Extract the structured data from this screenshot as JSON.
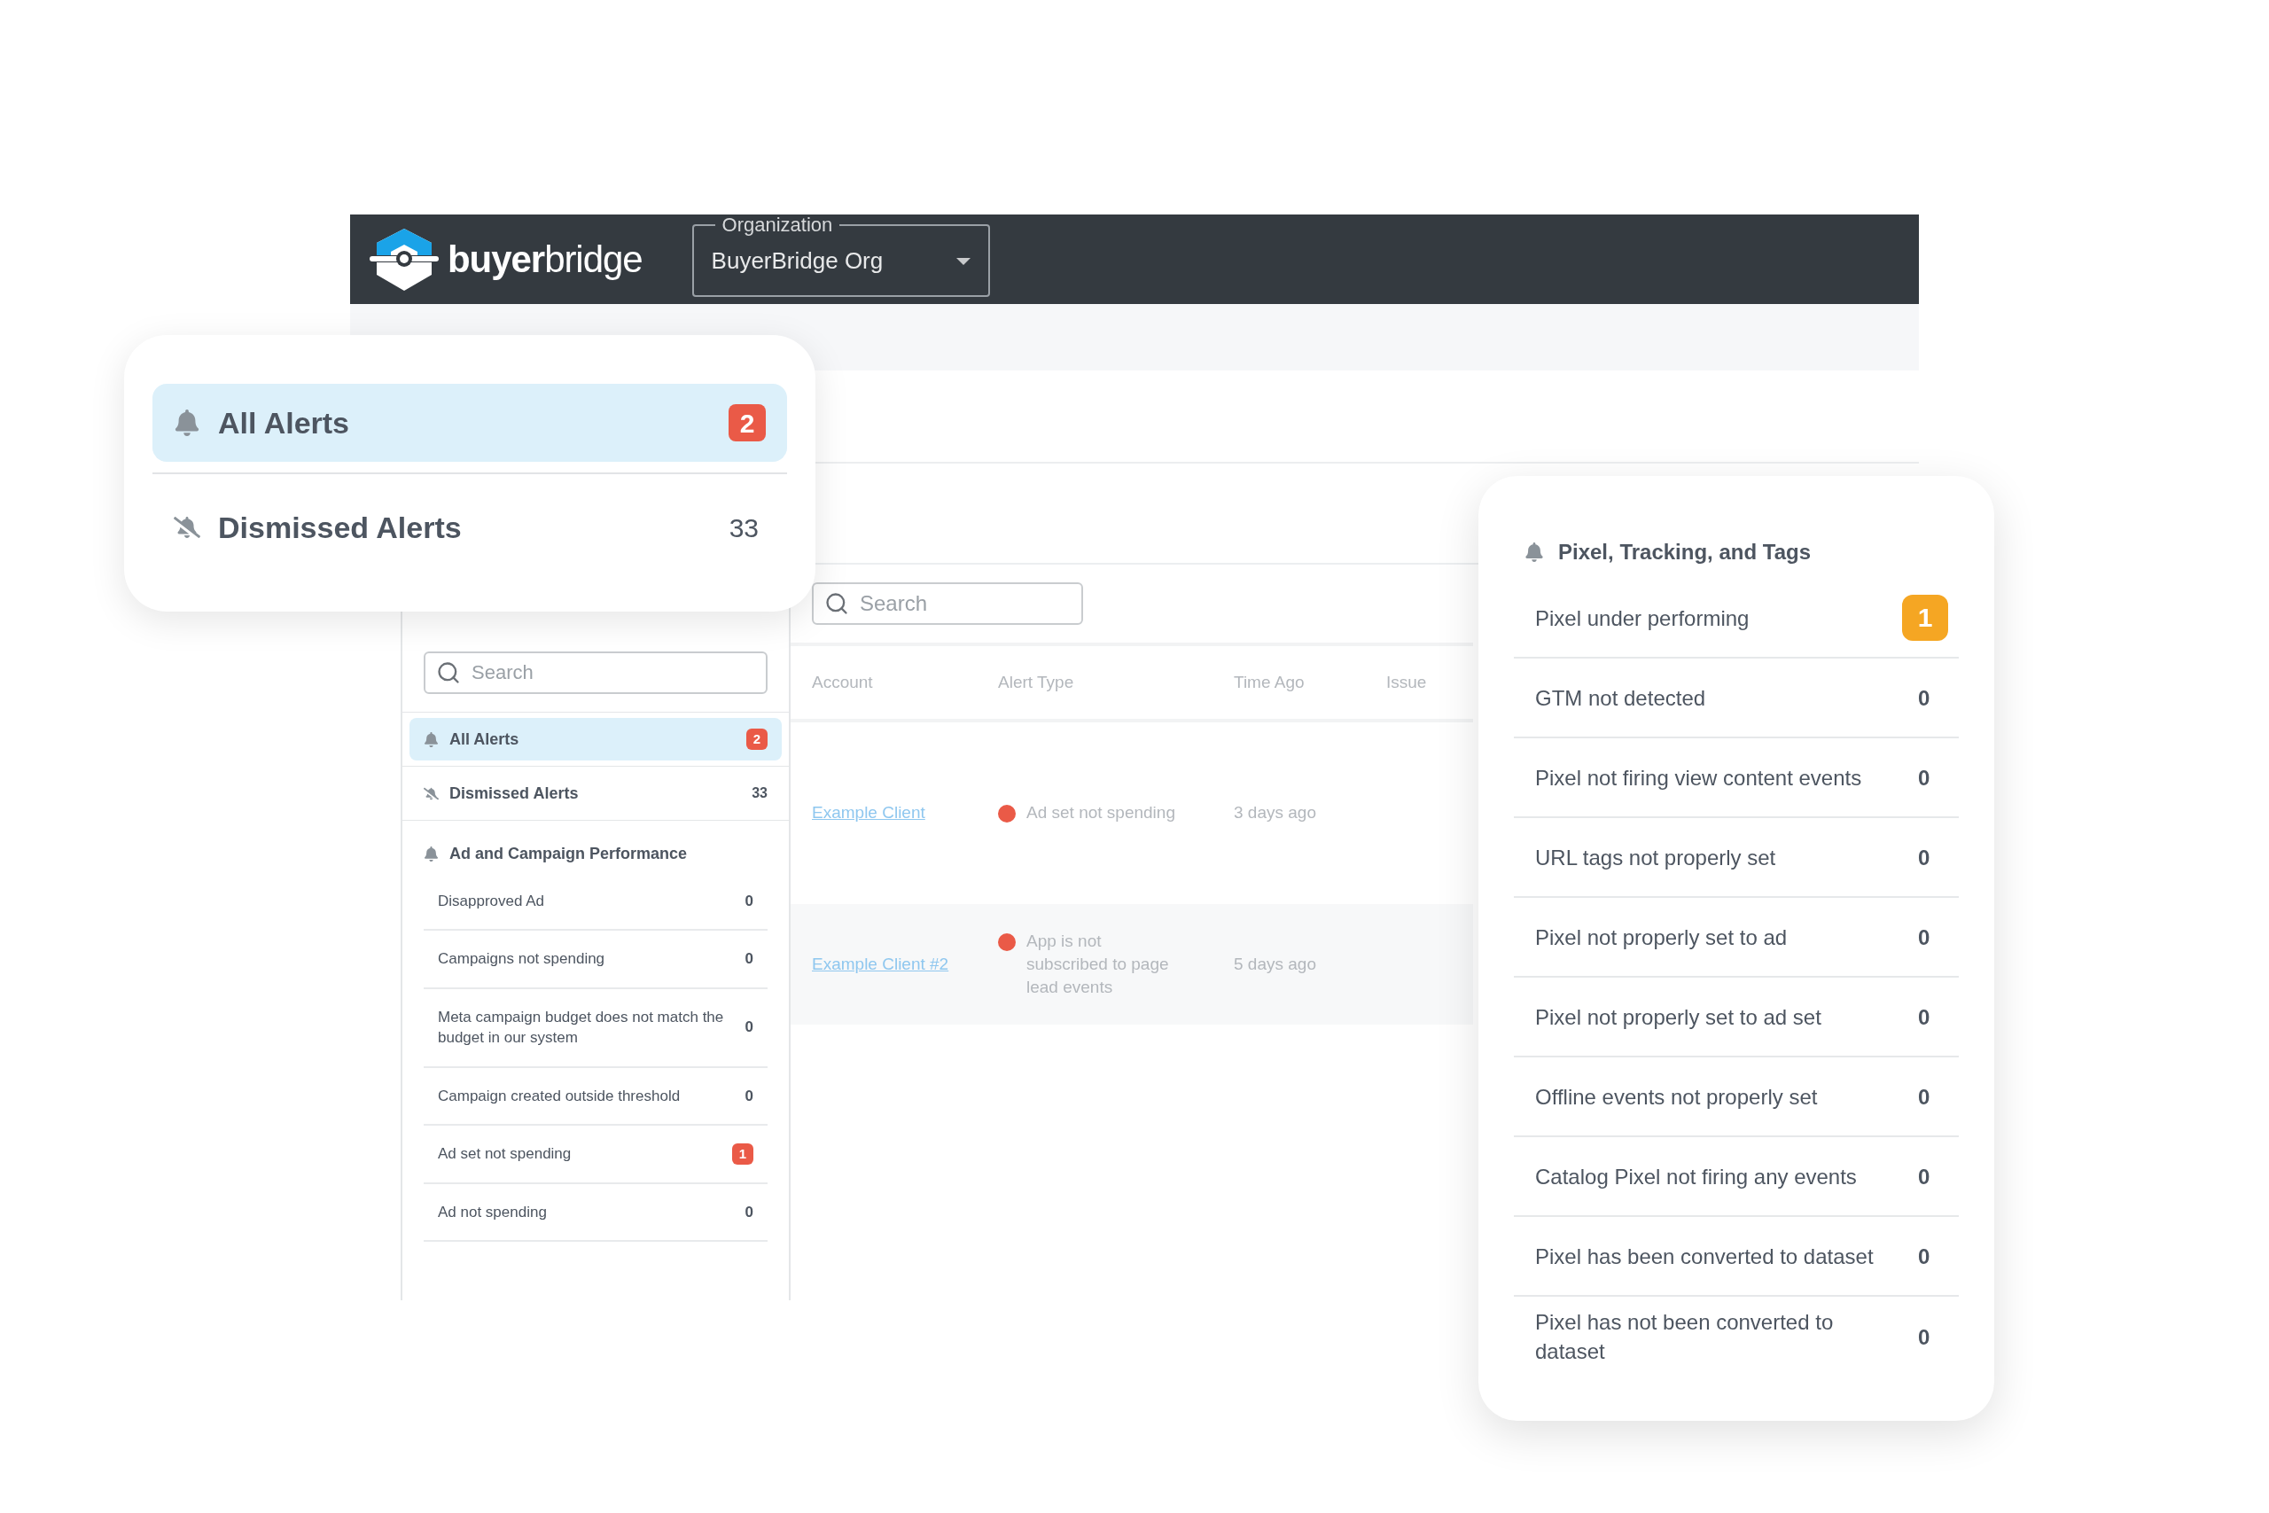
{
  "header": {
    "logo": "**buyer**bridge",
    "organization": {
      "label": "Organization",
      "value": "BuyerBridge Org"
    }
  },
  "alerts_card": {
    "items": [
      {
        "kind": "all",
        "label": "All Alerts",
        "count": "2",
        "selected": true,
        "alert": true,
        "color": "#ea5a47"
      },
      {
        "kind": "dismissed",
        "label": "Dismissed Alerts",
        "count": "33",
        "selected": false,
        "alert": false
      }
    ]
  },
  "sidebar": {
    "search": {
      "placeholder": "Search"
    },
    "items": [
      {
        "kind": "all",
        "label": "All Alerts",
        "count": "2",
        "selected": true,
        "alert": true,
        "color": "#ea5a47"
      },
      {
        "kind": "dismissed",
        "label": "Dismissed Alerts",
        "count": "33",
        "selected": false,
        "alert": false
      }
    ],
    "group": {
      "title": "Ad and Campaign Performance",
      "items": [
        {
          "label": "Disapproved Ad",
          "count": "0",
          "alert": false
        },
        {
          "label": "Campaigns not spending",
          "count": "0",
          "alert": false
        },
        {
          "label": "Meta campaign budget does not match the budget in our system",
          "count": "0",
          "alert": false
        },
        {
          "label": "Campaign created outside threshold",
          "count": "0",
          "alert": false
        },
        {
          "label": "Ad set not spending",
          "count": "1",
          "alert": true,
          "color": "#ea5a47"
        },
        {
          "label": "Ad not spending",
          "count": "0",
          "alert": false
        }
      ]
    }
  },
  "main": {
    "search": {
      "placeholder": "Search"
    },
    "table": {
      "columns": [
        "Account",
        "Alert Type",
        "Time Ago",
        "Issue"
      ],
      "rows": [
        {
          "account": "Example Client",
          "alert_type": "Ad set not spending",
          "time_ago": "3 days ago",
          "color": "#ea5a47"
        },
        {
          "account": "Example Client #2",
          "alert_type": "App is not subscribed to page lead events",
          "time_ago": "5 days ago",
          "color": "#ea5a47"
        }
      ]
    }
  },
  "pixel_card": {
    "title": "Pixel, Tracking, and Tags",
    "items": [
      {
        "label": "Pixel under performing",
        "count": "1",
        "alert": true,
        "color": "#f5a623"
      },
      {
        "label": "GTM not detected",
        "count": "0",
        "alert": false
      },
      {
        "label": "Pixel not firing view content events",
        "count": "0",
        "alert": false
      },
      {
        "label": "URL tags not properly set",
        "count": "0",
        "alert": false
      },
      {
        "label": "Pixel not properly set to ad",
        "count": "0",
        "alert": false
      },
      {
        "label": "Pixel not properly set to ad set",
        "count": "0",
        "alert": false
      },
      {
        "label": "Offline events not properly set",
        "count": "0",
        "alert": false
      },
      {
        "label": "Catalog Pixel not firing any events",
        "count": "0",
        "alert": false
      },
      {
        "label": "Pixel has been converted to dataset",
        "count": "0",
        "alert": false
      },
      {
        "label": "Pixel has not been converted to dataset",
        "count": "0",
        "alert": false
      }
    ]
  }
}
